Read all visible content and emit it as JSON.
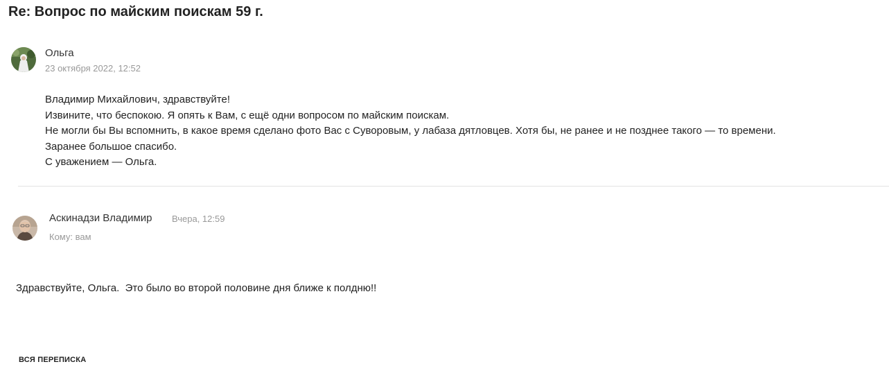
{
  "subject": "Re: Вопрос по майским поискам 59 г.",
  "messages": [
    {
      "sender": "Ольга",
      "date": "23 октября 2022, 12:52",
      "avatar_icon": "user-photo-olga",
      "body": [
        "Владимир Михайлович, здравствуйте!",
        "Извините, что беспокою. Я опять к Вам, с ещё одни вопросом по майским поискам.",
        "Не могли бы Вы вспомнить, в какое время сделано фото Вас с Суворовым, у лабаза дятловцев. Хотя бы, не ранее и не позднее такого — то времени.",
        "Заранее большое спасибо.",
        "С уважением — Ольга."
      ]
    },
    {
      "sender": "Аскинадзи Владимир",
      "date": "Вчера, 12:59",
      "to": "Кому: вам",
      "avatar_icon": "user-photo-askinadzi",
      "body": "Здравствуйте, Ольга.  Это было во второй половине дня ближе к полдню!!"
    }
  ],
  "footer": {
    "thread_link": "ВСЯ ПЕРЕПИСКА"
  }
}
